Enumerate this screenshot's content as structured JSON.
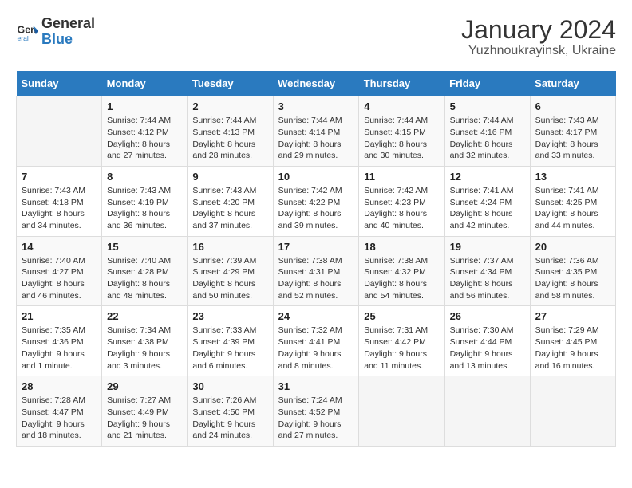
{
  "header": {
    "logo_line1": "General",
    "logo_line2": "Blue",
    "main_title": "January 2024",
    "subtitle": "Yuzhnoukrayinsk, Ukraine"
  },
  "calendar": {
    "days_of_week": [
      "Sunday",
      "Monday",
      "Tuesday",
      "Wednesday",
      "Thursday",
      "Friday",
      "Saturday"
    ],
    "weeks": [
      [
        {
          "day": "",
          "sunrise": "",
          "sunset": "",
          "daylight": ""
        },
        {
          "day": "1",
          "sunrise": "Sunrise: 7:44 AM",
          "sunset": "Sunset: 4:12 PM",
          "daylight": "Daylight: 8 hours and 27 minutes."
        },
        {
          "day": "2",
          "sunrise": "Sunrise: 7:44 AM",
          "sunset": "Sunset: 4:13 PM",
          "daylight": "Daylight: 8 hours and 28 minutes."
        },
        {
          "day": "3",
          "sunrise": "Sunrise: 7:44 AM",
          "sunset": "Sunset: 4:14 PM",
          "daylight": "Daylight: 8 hours and 29 minutes."
        },
        {
          "day": "4",
          "sunrise": "Sunrise: 7:44 AM",
          "sunset": "Sunset: 4:15 PM",
          "daylight": "Daylight: 8 hours and 30 minutes."
        },
        {
          "day": "5",
          "sunrise": "Sunrise: 7:44 AM",
          "sunset": "Sunset: 4:16 PM",
          "daylight": "Daylight: 8 hours and 32 minutes."
        },
        {
          "day": "6",
          "sunrise": "Sunrise: 7:43 AM",
          "sunset": "Sunset: 4:17 PM",
          "daylight": "Daylight: 8 hours and 33 minutes."
        }
      ],
      [
        {
          "day": "7",
          "sunrise": "Sunrise: 7:43 AM",
          "sunset": "Sunset: 4:18 PM",
          "daylight": "Daylight: 8 hours and 34 minutes."
        },
        {
          "day": "8",
          "sunrise": "Sunrise: 7:43 AM",
          "sunset": "Sunset: 4:19 PM",
          "daylight": "Daylight: 8 hours and 36 minutes."
        },
        {
          "day": "9",
          "sunrise": "Sunrise: 7:43 AM",
          "sunset": "Sunset: 4:20 PM",
          "daylight": "Daylight: 8 hours and 37 minutes."
        },
        {
          "day": "10",
          "sunrise": "Sunrise: 7:42 AM",
          "sunset": "Sunset: 4:22 PM",
          "daylight": "Daylight: 8 hours and 39 minutes."
        },
        {
          "day": "11",
          "sunrise": "Sunrise: 7:42 AM",
          "sunset": "Sunset: 4:23 PM",
          "daylight": "Daylight: 8 hours and 40 minutes."
        },
        {
          "day": "12",
          "sunrise": "Sunrise: 7:41 AM",
          "sunset": "Sunset: 4:24 PM",
          "daylight": "Daylight: 8 hours and 42 minutes."
        },
        {
          "day": "13",
          "sunrise": "Sunrise: 7:41 AM",
          "sunset": "Sunset: 4:25 PM",
          "daylight": "Daylight: 8 hours and 44 minutes."
        }
      ],
      [
        {
          "day": "14",
          "sunrise": "Sunrise: 7:40 AM",
          "sunset": "Sunset: 4:27 PM",
          "daylight": "Daylight: 8 hours and 46 minutes."
        },
        {
          "day": "15",
          "sunrise": "Sunrise: 7:40 AM",
          "sunset": "Sunset: 4:28 PM",
          "daylight": "Daylight: 8 hours and 48 minutes."
        },
        {
          "day": "16",
          "sunrise": "Sunrise: 7:39 AM",
          "sunset": "Sunset: 4:29 PM",
          "daylight": "Daylight: 8 hours and 50 minutes."
        },
        {
          "day": "17",
          "sunrise": "Sunrise: 7:38 AM",
          "sunset": "Sunset: 4:31 PM",
          "daylight": "Daylight: 8 hours and 52 minutes."
        },
        {
          "day": "18",
          "sunrise": "Sunrise: 7:38 AM",
          "sunset": "Sunset: 4:32 PM",
          "daylight": "Daylight: 8 hours and 54 minutes."
        },
        {
          "day": "19",
          "sunrise": "Sunrise: 7:37 AM",
          "sunset": "Sunset: 4:34 PM",
          "daylight": "Daylight: 8 hours and 56 minutes."
        },
        {
          "day": "20",
          "sunrise": "Sunrise: 7:36 AM",
          "sunset": "Sunset: 4:35 PM",
          "daylight": "Daylight: 8 hours and 58 minutes."
        }
      ],
      [
        {
          "day": "21",
          "sunrise": "Sunrise: 7:35 AM",
          "sunset": "Sunset: 4:36 PM",
          "daylight": "Daylight: 9 hours and 1 minute."
        },
        {
          "day": "22",
          "sunrise": "Sunrise: 7:34 AM",
          "sunset": "Sunset: 4:38 PM",
          "daylight": "Daylight: 9 hours and 3 minutes."
        },
        {
          "day": "23",
          "sunrise": "Sunrise: 7:33 AM",
          "sunset": "Sunset: 4:39 PM",
          "daylight": "Daylight: 9 hours and 6 minutes."
        },
        {
          "day": "24",
          "sunrise": "Sunrise: 7:32 AM",
          "sunset": "Sunset: 4:41 PM",
          "daylight": "Daylight: 9 hours and 8 minutes."
        },
        {
          "day": "25",
          "sunrise": "Sunrise: 7:31 AM",
          "sunset": "Sunset: 4:42 PM",
          "daylight": "Daylight: 9 hours and 11 minutes."
        },
        {
          "day": "26",
          "sunrise": "Sunrise: 7:30 AM",
          "sunset": "Sunset: 4:44 PM",
          "daylight": "Daylight: 9 hours and 13 minutes."
        },
        {
          "day": "27",
          "sunrise": "Sunrise: 7:29 AM",
          "sunset": "Sunset: 4:45 PM",
          "daylight": "Daylight: 9 hours and 16 minutes."
        }
      ],
      [
        {
          "day": "28",
          "sunrise": "Sunrise: 7:28 AM",
          "sunset": "Sunset: 4:47 PM",
          "daylight": "Daylight: 9 hours and 18 minutes."
        },
        {
          "day": "29",
          "sunrise": "Sunrise: 7:27 AM",
          "sunset": "Sunset: 4:49 PM",
          "daylight": "Daylight: 9 hours and 21 minutes."
        },
        {
          "day": "30",
          "sunrise": "Sunrise: 7:26 AM",
          "sunset": "Sunset: 4:50 PM",
          "daylight": "Daylight: 9 hours and 24 minutes."
        },
        {
          "day": "31",
          "sunrise": "Sunrise: 7:24 AM",
          "sunset": "Sunset: 4:52 PM",
          "daylight": "Daylight: 9 hours and 27 minutes."
        },
        {
          "day": "",
          "sunrise": "",
          "sunset": "",
          "daylight": ""
        },
        {
          "day": "",
          "sunrise": "",
          "sunset": "",
          "daylight": ""
        },
        {
          "day": "",
          "sunrise": "",
          "sunset": "",
          "daylight": ""
        }
      ]
    ]
  }
}
